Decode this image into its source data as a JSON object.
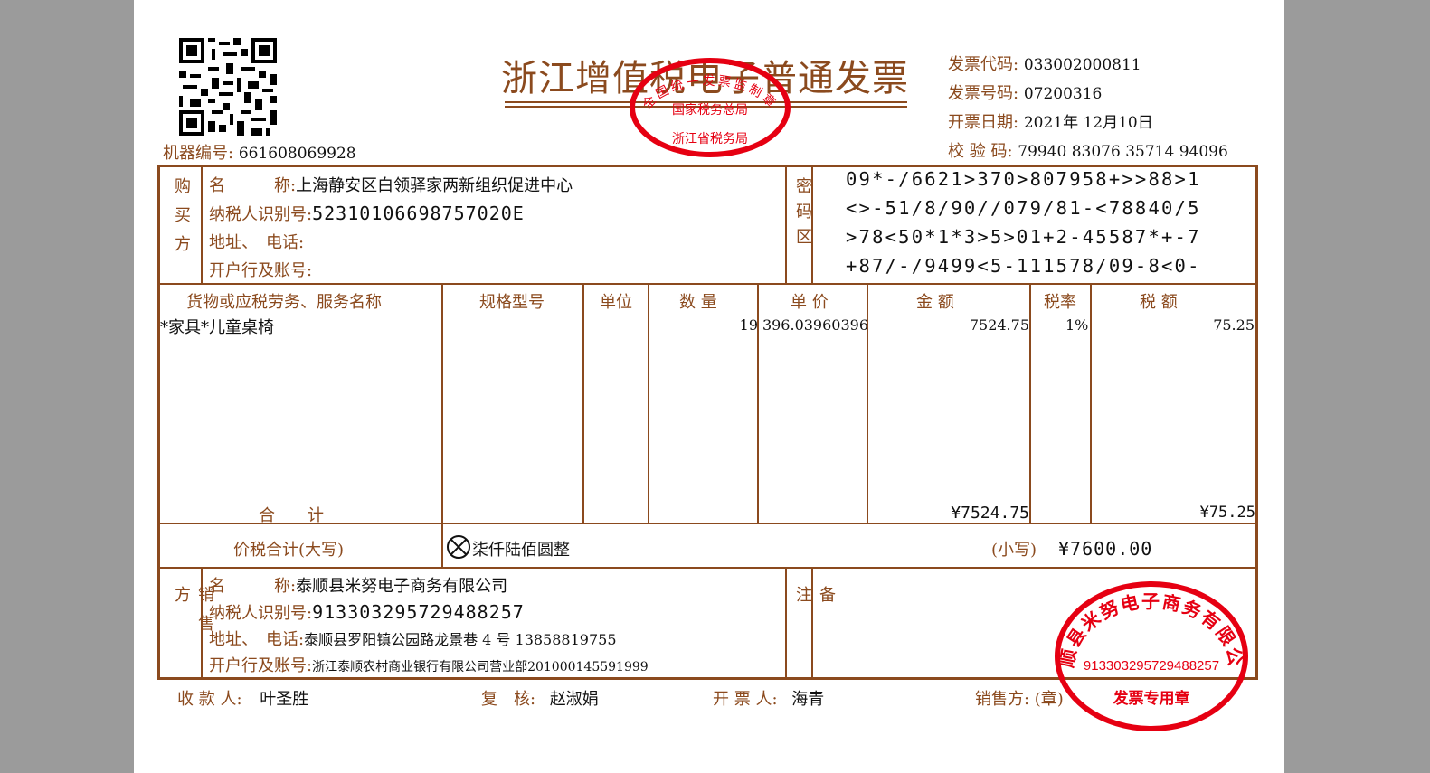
{
  "invoice": {
    "title": "浙江增值税电子普通发票",
    "machine_no_label": "机器编号:",
    "machine_no": "661608069928",
    "meta": [
      {
        "label": "发票代码:",
        "value": "033002000811"
      },
      {
        "label": "发票号码:",
        "value": "07200316"
      },
      {
        "label": "开票日期:",
        "value": "2021年 12月10日"
      },
      {
        "label": "校 验 码:",
        "value": "79940 83076 35714 94096"
      }
    ],
    "tax_seal": {
      "top": "全国统一发票监制章",
      "mid": "国家税务总局",
      "bottom": "浙江省税务局"
    }
  },
  "buyer": {
    "section_label": "购买方",
    "name_label": "名　　　称:",
    "name": "上海静安区白领驿家两新组织促进中心",
    "tax_id_label": "纳税人识别号:",
    "tax_id": "52310106698757020E",
    "address_label": "地址、　电话:",
    "bank_label": "开户行及账号:"
  },
  "cipher": {
    "label": "密码区",
    "lines": [
      "09*-/6621>370>807958+>>88>1",
      "<>-51/8/90//079/81-<78840/5",
      ">78<50*1*3>5>01+2-45587*+-7",
      "+87/-/9499<5-111578/09-8<0-"
    ]
  },
  "items": {
    "headers": [
      "货物或应税劳务、服务名称",
      "规格型号",
      "单位",
      "数 量",
      "单 价",
      "金 额",
      "税率",
      "税 额"
    ],
    "rows": [
      {
        "name": "*家具*儿童桌椅",
        "spec": "",
        "unit": "",
        "qty": "19",
        "price": "396.03960396",
        "amount": "7524.75",
        "rate": "1%",
        "tax": "75.25"
      }
    ],
    "total_label": "合　　计",
    "total_amount": "¥7524.75",
    "total_tax": "¥75.25"
  },
  "grand_total": {
    "label": "价税合计(大写)",
    "uppercase": "柒仟陆佰圆整",
    "small_label": "(小写)",
    "small": "¥7600.00"
  },
  "seller": {
    "section_label": "销售方",
    "name_label": "名　　　称:",
    "name": "泰顺县米努电子商务有限公司",
    "tax_id_label": "纳税人识别号:",
    "tax_id": "913303295729488257",
    "address_label": "地址、　电话:",
    "address": "泰顺县罗阳镇公园路龙景巷 4 号 13858819755",
    "bank_label": "开户行及账号:",
    "bank": "浙江泰顺农村商业银行有限公司营业部201000145591999"
  },
  "remarks_label": "备注",
  "footer": {
    "payee_label": "收 款 人:",
    "payee": "叶圣胜",
    "reviewer_label": "复　核:",
    "reviewer": "赵淑娟",
    "issuer_label": "开 票 人:",
    "issuer": "海青",
    "seller_label": "销售方: (章)"
  },
  "seller_seal": {
    "name": "泰顺县米努电子商务有限公司",
    "tax_id": "913303295729488257",
    "bottom": "发票专用章"
  },
  "colors": {
    "frame": "#8b4a1e",
    "seal": "#e60012"
  }
}
